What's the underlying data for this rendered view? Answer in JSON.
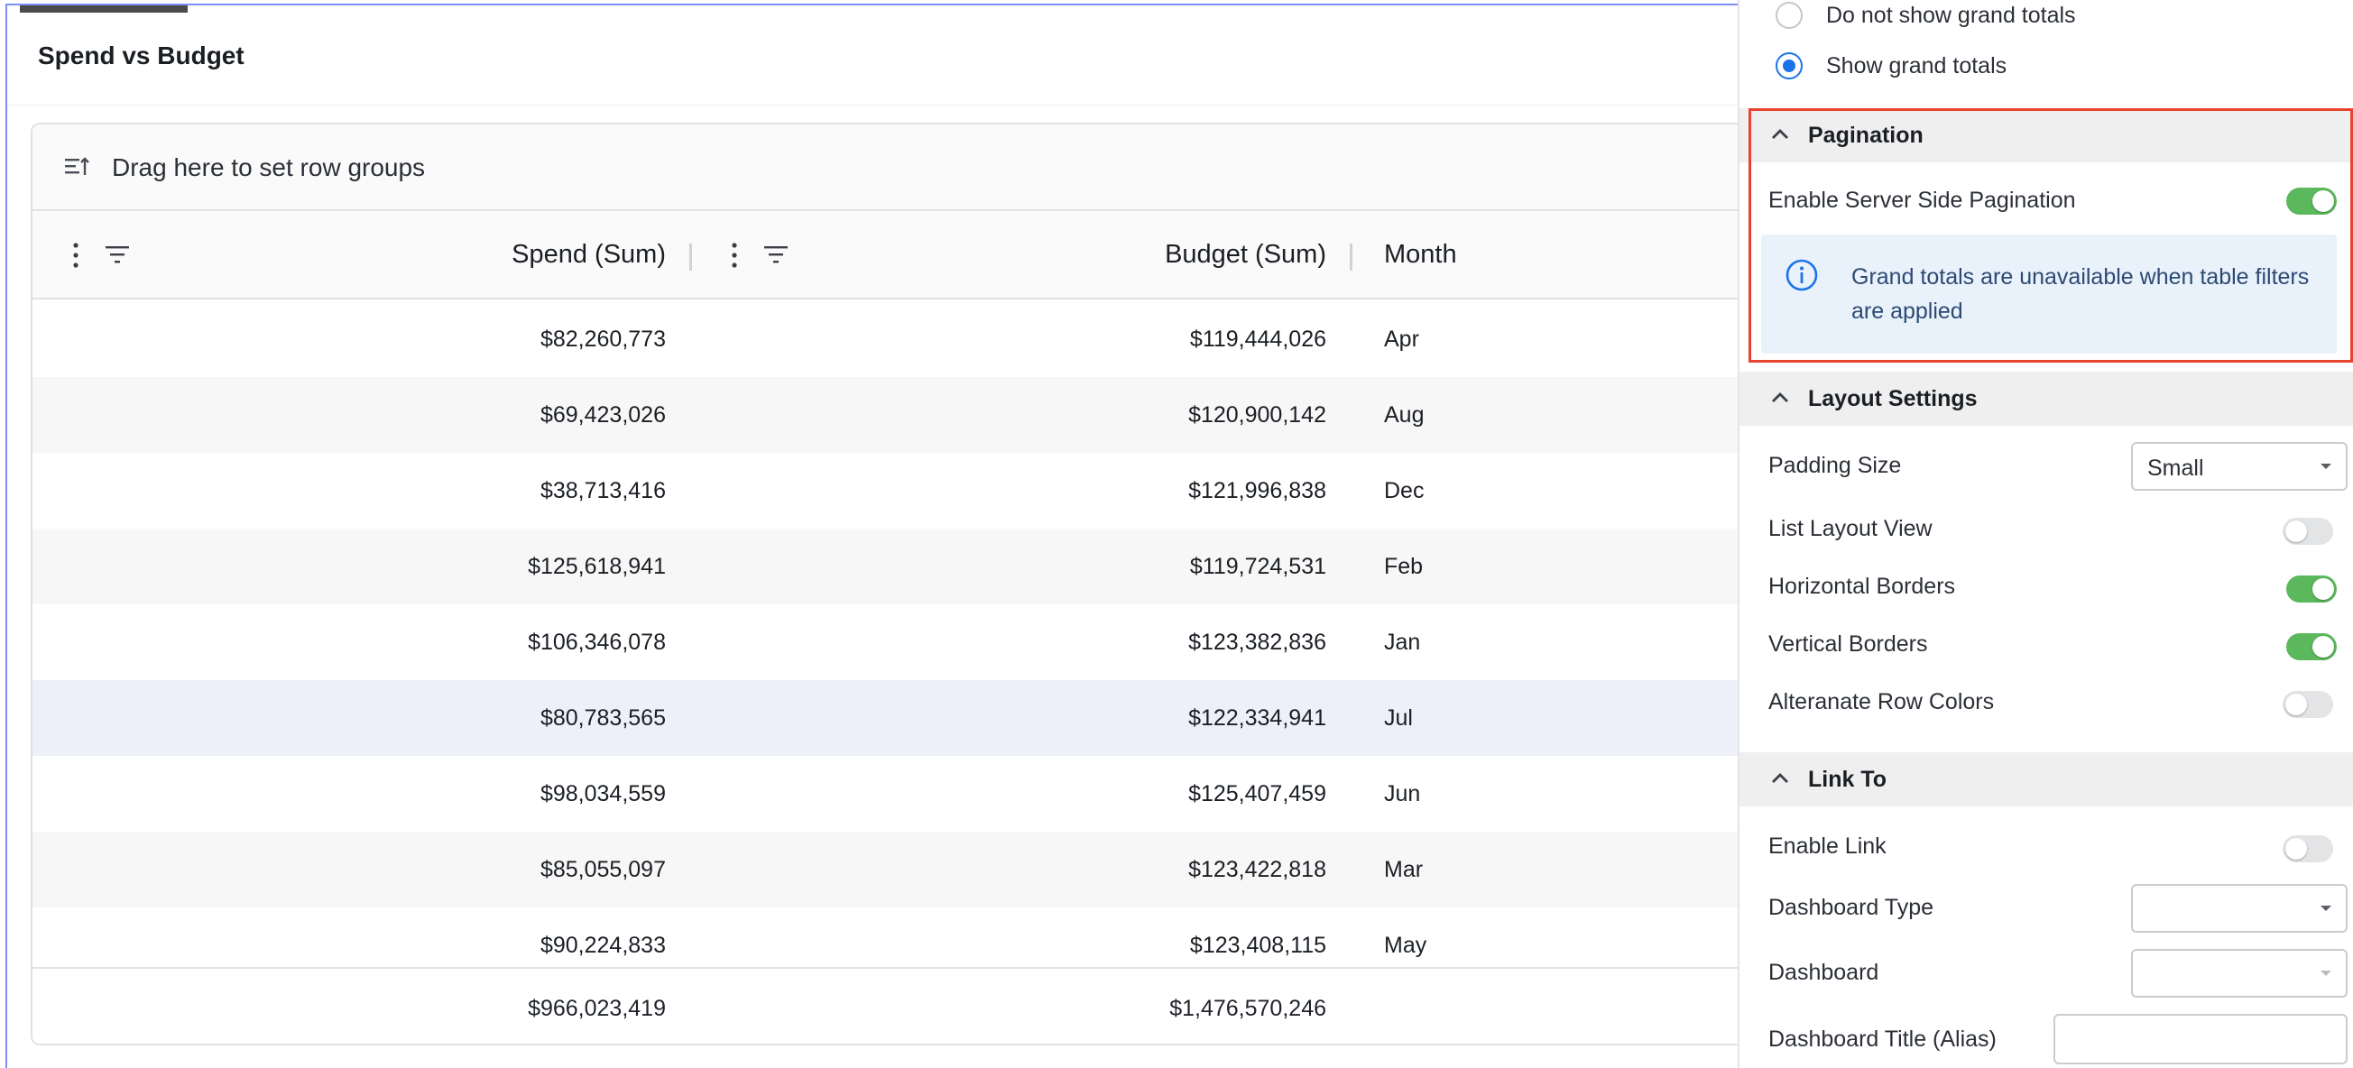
{
  "widget": {
    "title": "Spend vs Budget",
    "group_bar_text": "Drag here to set row groups",
    "columns": [
      "Spend (Sum)",
      "Budget (Sum)",
      "Month"
    ],
    "rows": [
      {
        "spend": "$82,260,773",
        "budget": "$119,444,026",
        "month": "Apr"
      },
      {
        "spend": "$69,423,026",
        "budget": "$120,900,142",
        "month": "Aug"
      },
      {
        "spend": "$38,713,416",
        "budget": "$121,996,838",
        "month": "Dec"
      },
      {
        "spend": "$125,618,941",
        "budget": "$119,724,531",
        "month": "Feb"
      },
      {
        "spend": "$106,346,078",
        "budget": "$123,382,836",
        "month": "Jan"
      },
      {
        "spend": "$80,783,565",
        "budget": "$122,334,941",
        "month": "Jul"
      },
      {
        "spend": "$98,034,559",
        "budget": "$125,407,459",
        "month": "Jun"
      },
      {
        "spend": "$85,055,097",
        "budget": "$123,422,818",
        "month": "Mar"
      },
      {
        "spend": "$90,224,833",
        "budget": "$123,408,115",
        "month": "May"
      }
    ],
    "totals": {
      "spend": "$966,023,419",
      "budget": "$1,476,570,246"
    }
  },
  "panel": {
    "grand_totals": {
      "option_hide": "Do not show grand totals",
      "option_show": "Show grand totals",
      "selected": "show"
    },
    "pagination": {
      "title": "Pagination",
      "server_side_label": "Enable Server Side Pagination",
      "server_side_enabled": true,
      "info_text": "Grand totals are unavailable when table filters are applied"
    },
    "layout": {
      "title": "Layout Settings",
      "padding_label": "Padding Size",
      "padding_value": "Small",
      "list_layout_label": "List Layout View",
      "list_layout_enabled": false,
      "horizontal_borders_label": "Horizontal Borders",
      "horizontal_borders_enabled": true,
      "vertical_borders_label": "Vertical Borders",
      "vertical_borders_enabled": true,
      "alt_row_colors_label": "Alteranate Row Colors",
      "alt_row_colors_enabled": false
    },
    "link_to": {
      "title": "Link To",
      "enable_link_label": "Enable Link",
      "enable_link_enabled": false,
      "dashboard_type_label": "Dashboard Type",
      "dashboard_type_value": "",
      "dashboard_label": "Dashboard",
      "dashboard_value": "",
      "dashboard_title_label": "Dashboard Title (Alias)",
      "dashboard_title_value": ""
    }
  },
  "colors": {
    "accent": "#1a73e8",
    "toggle_on": "#5cb85c",
    "highlight_border": "#e8432f",
    "info_background": "#e9f1fb",
    "selected_row": "#edf0f8"
  },
  "icons": [
    "row-groups-icon",
    "kebab-menu-icon",
    "filter-icon",
    "info-icon",
    "chevron-up-icon",
    "dropdown-caret-icon"
  ]
}
